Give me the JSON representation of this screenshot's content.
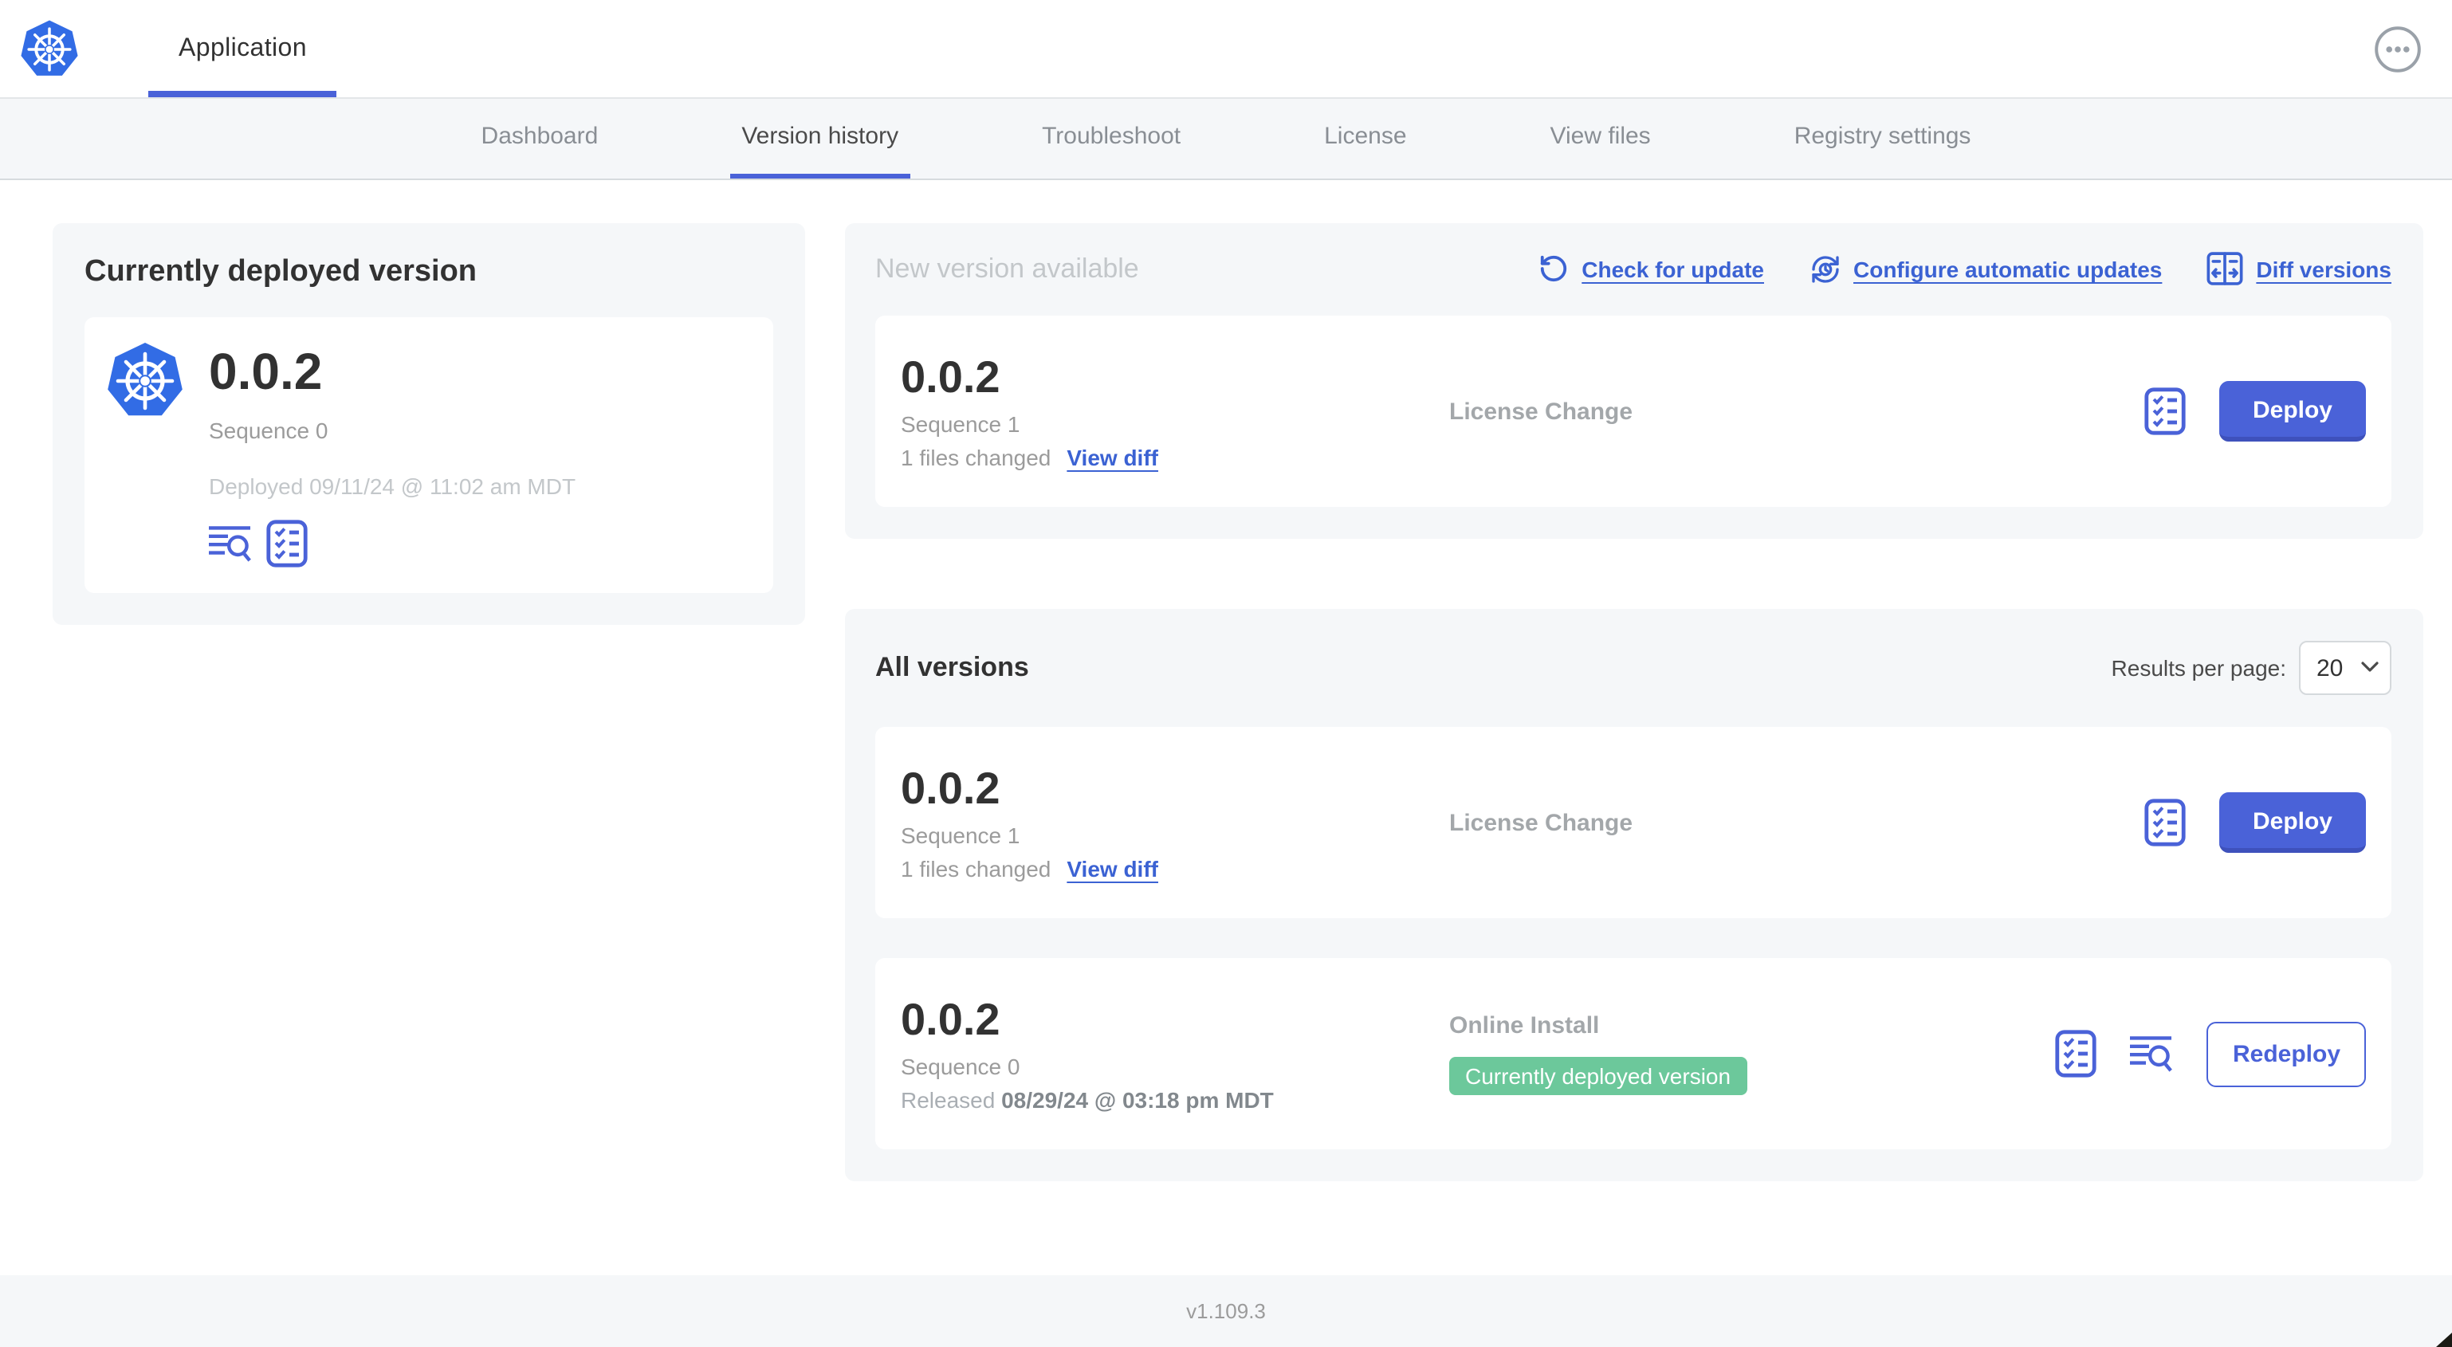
{
  "header": {
    "app_title": "Application"
  },
  "tabs": {
    "items": [
      {
        "label": "Dashboard",
        "active": false
      },
      {
        "label": "Version history",
        "active": true
      },
      {
        "label": "Troubleshoot",
        "active": false
      },
      {
        "label": "License",
        "active": false
      },
      {
        "label": "View files",
        "active": false
      },
      {
        "label": "Registry settings",
        "active": false
      }
    ]
  },
  "currently_deployed": {
    "title": "Currently deployed version",
    "version": "0.0.2",
    "sequence": "Sequence 0",
    "deployed_at": "Deployed 09/11/24 @ 11:02 am MDT",
    "icons": [
      "deploy-logs-icon",
      "preflight-checks-icon"
    ]
  },
  "new_version": {
    "title": "New version available",
    "actions": {
      "check_for_update": "Check for update",
      "configure_automatic_updates": "Configure automatic updates",
      "diff_versions": "Diff versions"
    },
    "row": {
      "version": "0.0.2",
      "sequence": "Sequence 1",
      "files_changed": "1 files changed",
      "view_diff": "View diff",
      "source": "License Change",
      "action_label": "Deploy",
      "icons": [
        "preflight-checks-icon"
      ]
    }
  },
  "all_versions": {
    "title": "All versions",
    "results_per_page_label": "Results per page:",
    "results_per_page_value": "20",
    "rows": [
      {
        "version": "0.0.2",
        "sequence": "Sequence 1",
        "files_changed": "1 files changed",
        "view_diff": "View diff",
        "source": "License Change",
        "action_label": "Deploy",
        "icons": [
          "preflight-checks-icon"
        ]
      },
      {
        "version": "0.0.2",
        "sequence": "Sequence 0",
        "released_label": "Released",
        "released_date": "08/29/24 @ 03:18 pm MDT",
        "source": "Online Install",
        "badge": "Currently deployed version",
        "action_label": "Redeploy",
        "icons": [
          "preflight-checks-icon",
          "deploy-logs-icon"
        ]
      }
    ]
  },
  "footer": {
    "app_version": "v1.109.3"
  },
  "colors": {
    "accent_blue": "#4A62D8",
    "link_blue": "#3B62D3",
    "kubernetes_blue": "#326CE5",
    "badge_green": "#6CC89B",
    "panel_background": "#F5F7F9"
  }
}
